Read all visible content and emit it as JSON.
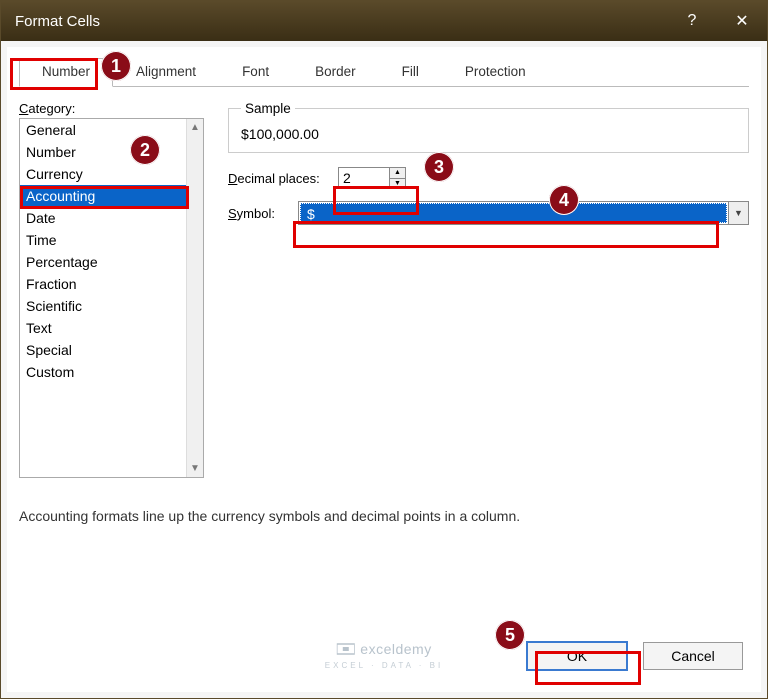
{
  "window": {
    "title": "Format Cells",
    "help_icon": "?",
    "close_icon": "✕"
  },
  "tabs": [
    "Number",
    "Alignment",
    "Font",
    "Border",
    "Fill",
    "Protection"
  ],
  "active_tab": "Number",
  "category": {
    "label": "Category:",
    "items": [
      "General",
      "Number",
      "Currency",
      "Accounting",
      "Date",
      "Time",
      "Percentage",
      "Fraction",
      "Scientific",
      "Text",
      "Special",
      "Custom"
    ],
    "selected": "Accounting"
  },
  "sample": {
    "label": "Sample",
    "value": "$100,000.00"
  },
  "decimal": {
    "label": "Decimal places:",
    "value": "2"
  },
  "symbol": {
    "label": "Symbol:",
    "value": "$"
  },
  "description": "Accounting formats line up the currency symbols and decimal points in a column.",
  "buttons": {
    "ok": "OK",
    "cancel": "Cancel"
  },
  "watermark": {
    "main": "exceldemy",
    "sub": "EXCEL · DATA · BI"
  },
  "callouts": [
    "1",
    "2",
    "3",
    "4",
    "5"
  ]
}
